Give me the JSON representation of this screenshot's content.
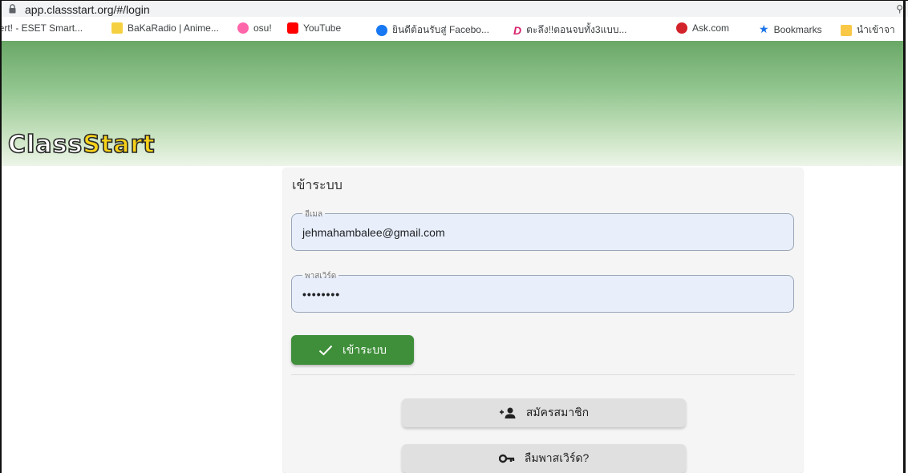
{
  "browser": {
    "url": "app.classstart.org/#/login",
    "bookmarks": [
      {
        "label": "lert! - ESET Smart...",
        "icon": "eset-icon",
        "color": "#00a3a6"
      },
      {
        "label": "BaKaRadio | Anime...",
        "icon": "bakaradio-icon",
        "color": "#e6b800"
      },
      {
        "label": "osu!",
        "icon": "osu-icon",
        "color": "#ff66aa"
      },
      {
        "label": "YouTube",
        "icon": "youtube-icon",
        "color": "#ff0000"
      },
      {
        "label": "ยินดีต้อนรับสู่ Facebo...",
        "icon": "facebook-icon",
        "color": "#1877f2"
      },
      {
        "label": "ตะลึง!!ตอนจบทั้ง3แบบ...",
        "icon": "dek-d-icon",
        "color": "#e8402a"
      },
      {
        "label": "Ask.com",
        "icon": "ask-icon",
        "color": "#d2232a"
      },
      {
        "label": "Bookmarks",
        "icon": "star-icon",
        "color": "#1a73e8"
      },
      {
        "label": "นำเข้าจา",
        "icon": "folder-icon",
        "color": "#f9c846"
      }
    ]
  },
  "header": {
    "logo_part1": "Class",
    "logo_part2": "Start"
  },
  "login": {
    "title": "เข้าระบบ",
    "email_label": "อีเมล",
    "email_value": "jehmahambalee@gmail.com",
    "password_label": "พาสเวิร์ด",
    "password_value": "••••••••",
    "submit_label": "เข้าระบบ",
    "register_label": "สมัครสมาชิก",
    "forgot_label": "ลืมพาสเวิร์ด?"
  },
  "colors": {
    "primary_green": "#3f8f3a",
    "banner_green": "#6aa867",
    "field_bg": "#e8effb"
  }
}
